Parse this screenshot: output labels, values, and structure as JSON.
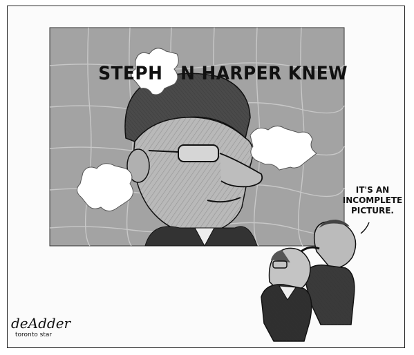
{
  "cartoon": {
    "puzzle_title_left": "STEPH",
    "puzzle_title_right": "N HARPER KNEW",
    "speech_lines": [
      "IT'S AN",
      "INCOMPLETE",
      "PICTURE."
    ],
    "signature": "deAdder",
    "newspaper": "toronto star"
  },
  "icons": {
    "puzzle": "jigsaw-puzzle-icon",
    "missing_piece": "missing-piece-icon",
    "man": "man-figure-icon"
  }
}
